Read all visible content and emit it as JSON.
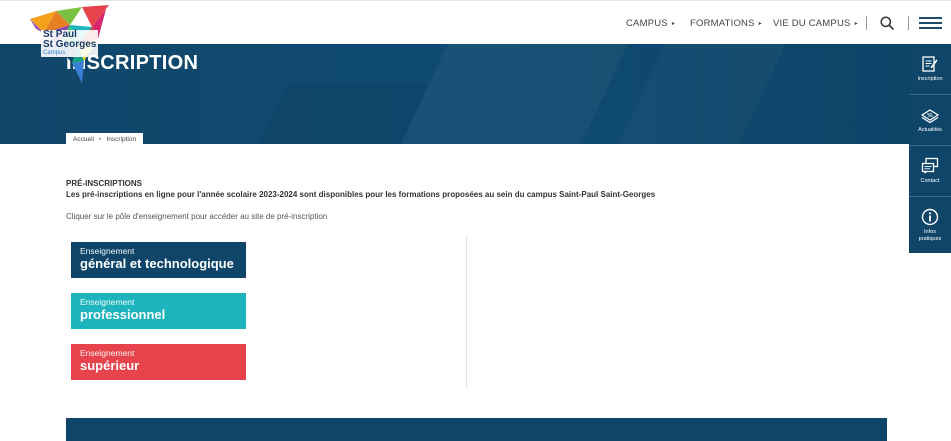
{
  "header": {
    "logo": {
      "line1": "St Paul",
      "line2": "St Georges",
      "line3": "Campus"
    },
    "nav": [
      {
        "label": "CAMPUS"
      },
      {
        "label": "FORMATIONS"
      },
      {
        "label": "VIE DU CAMPUS"
      }
    ],
    "search_icon": "search-icon",
    "menu_icon": "hamburger-menu-icon"
  },
  "hero": {
    "title": "INSCRIPTION",
    "breadcrumb": [
      "Accueil",
      "Inscription"
    ]
  },
  "side_panel": [
    {
      "label": "Inscription",
      "icon": "form-edit-icon"
    },
    {
      "label": "Actualités",
      "icon": "newspaper-icon"
    },
    {
      "label": "Contact",
      "icon": "chat-bubbles-icon"
    },
    {
      "label": "Infos pratiques",
      "icon": "info-circle-icon"
    }
  ],
  "content": {
    "title": "PRÉ-INSCRIPTIONS",
    "description": "Les pré-inscriptions en ligne pour l'année scolaire 2023-2024 sont disponibles pour les formations proposées au sein du campus Saint-Paul Saint-Georges",
    "hint": "Cliquer sur le pôle d'enseignement pour accéder au site de pré-inscription",
    "poles": [
      {
        "small": "Enseignement",
        "big": "général et technologique",
        "color": "#0e4569"
      },
      {
        "small": "Enseignement",
        "big": "professionnel",
        "color": "#1eb4bd"
      },
      {
        "small": "Enseignement",
        "big": "supérieur",
        "color": "#e6434c"
      }
    ]
  },
  "colors": {
    "primary": "#0e4569",
    "teal": "#1eb4bd",
    "red": "#e6434c"
  }
}
